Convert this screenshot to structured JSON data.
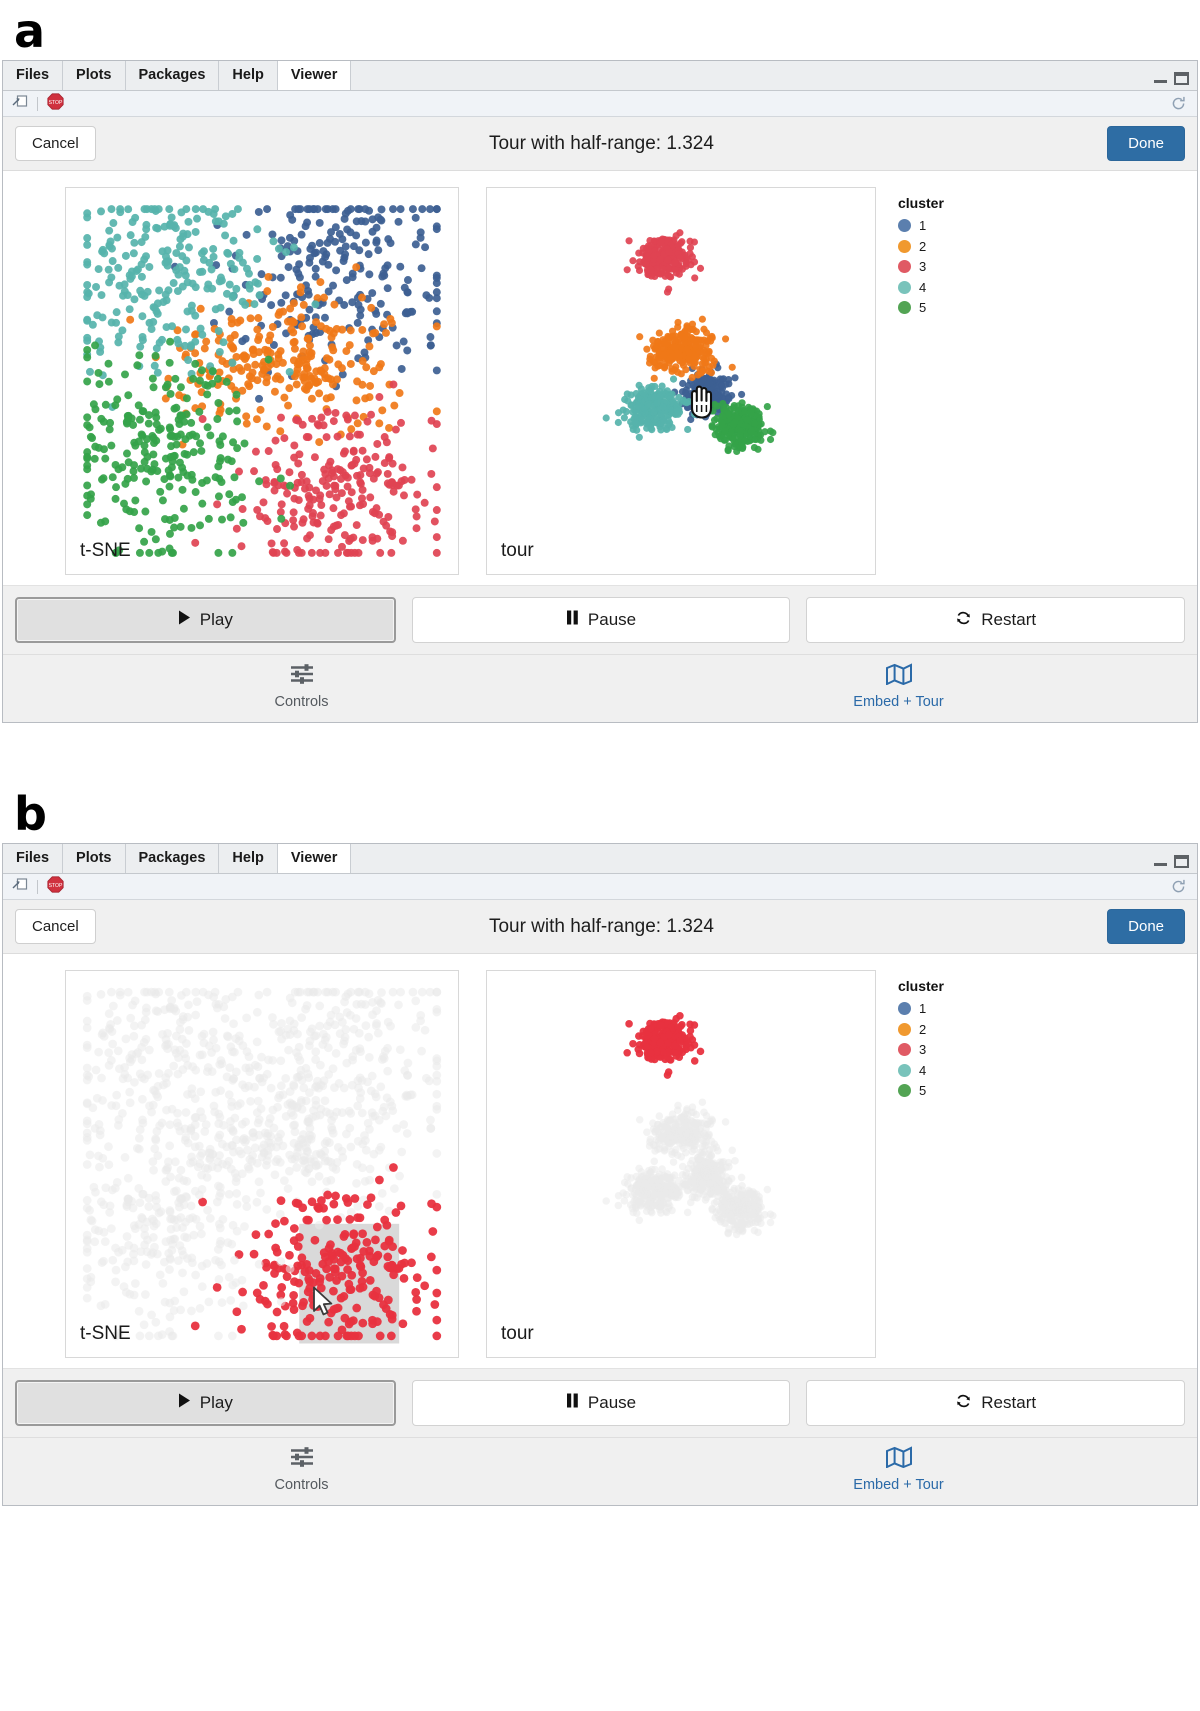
{
  "panels": [
    {
      "letter": "a",
      "tabs": [
        {
          "label": "Files",
          "active": false
        },
        {
          "label": "Plots",
          "active": false
        },
        {
          "label": "Packages",
          "active": false
        },
        {
          "label": "Help",
          "active": false
        },
        {
          "label": "Viewer",
          "active": true
        }
      ],
      "window_controls": {
        "minimize": "minimize-icon",
        "maximize": "maximize-icon"
      },
      "toolbar": {
        "popout": "popout-window-icon",
        "stop": "stop-icon",
        "refresh": "refresh-icon"
      },
      "header": {
        "cancel_label": "Cancel",
        "title": "Tour with half-range: 1.324",
        "done_label": "Done"
      },
      "plots": {
        "left_label": "t-SNE",
        "right_label": "tour",
        "faded": false,
        "selection_rect": false,
        "cursor": "hand-cursor-on-tour"
      },
      "legend": {
        "title": "cluster",
        "items": [
          {
            "label": "1",
            "color": "#5b7fae"
          },
          {
            "label": "2",
            "color": "#f0992f"
          },
          {
            "label": "3",
            "color": "#e05a64"
          },
          {
            "label": "4",
            "color": "#79c3bb"
          },
          {
            "label": "5",
            "color": "#53a454"
          }
        ]
      },
      "transport": [
        {
          "label": "Play",
          "icon": "play-icon",
          "pressed": true
        },
        {
          "label": "Pause",
          "icon": "pause-icon",
          "pressed": false
        },
        {
          "label": "Restart",
          "icon": "restart-icon",
          "pressed": false
        }
      ],
      "footer": [
        {
          "label": "Controls",
          "icon": "sliders-icon",
          "accent": false
        },
        {
          "label": "Embed + Tour",
          "icon": "map-icon",
          "accent": true
        }
      ]
    },
    {
      "letter": "b",
      "tabs": [
        {
          "label": "Files",
          "active": false
        },
        {
          "label": "Plots",
          "active": false
        },
        {
          "label": "Packages",
          "active": false
        },
        {
          "label": "Help",
          "active": false
        },
        {
          "label": "Viewer",
          "active": true
        }
      ],
      "window_controls": {
        "minimize": "minimize-icon",
        "maximize": "maximize-icon"
      },
      "toolbar": {
        "popout": "popout-window-icon",
        "stop": "stop-icon",
        "refresh": "refresh-icon"
      },
      "header": {
        "cancel_label": "Cancel",
        "title": "Tour with half-range: 1.324",
        "done_label": "Done"
      },
      "plots": {
        "left_label": "t-SNE",
        "right_label": "tour",
        "faded": true,
        "selection_rect": true,
        "cursor": "arrow-cursor-on-tsne"
      },
      "legend": {
        "title": "cluster",
        "items": [
          {
            "label": "1",
            "color": "#5b7fae"
          },
          {
            "label": "2",
            "color": "#f0992f"
          },
          {
            "label": "3",
            "color": "#e05a64"
          },
          {
            "label": "4",
            "color": "#79c3bb"
          },
          {
            "label": "5",
            "color": "#53a454"
          }
        ]
      },
      "transport": [
        {
          "label": "Play",
          "icon": "play-icon",
          "pressed": true
        },
        {
          "label": "Pause",
          "icon": "pause-icon",
          "pressed": false
        },
        {
          "label": "Restart",
          "icon": "restart-icon",
          "pressed": false
        }
      ],
      "footer": [
        {
          "label": "Controls",
          "icon": "sliders-icon",
          "accent": false
        },
        {
          "label": "Embed + Tour",
          "icon": "map-icon",
          "accent": true
        }
      ]
    }
  ],
  "chart_data": {
    "type": "scatter",
    "title": "t-SNE embedding and linked tour projection of 5 clusters",
    "xlabel": "",
    "ylabel": "",
    "grid": false,
    "legend_position": "right",
    "legend_title": "cluster",
    "series": [
      {
        "name": "1",
        "color": "#3d5f93",
        "n": 230,
        "tsne_center": [
          0.74,
          0.8
        ],
        "tsne_spread": [
          0.155,
          0.135
        ],
        "tour_center": [
          0.575,
          0.465
        ],
        "tour_spread": [
          0.03,
          0.028
        ]
      },
      {
        "name": "2",
        "color": "#f07818",
        "n": 250,
        "tsne_center": [
          0.565,
          0.555
        ],
        "tsne_spread": [
          0.15,
          0.09
        ],
        "tour_center": [
          0.505,
          0.585
        ],
        "tour_spread": [
          0.042,
          0.03
        ]
      },
      {
        "name": "3",
        "color": "#e04352",
        "n": 235,
        "tsne_center": [
          0.705,
          0.195
        ],
        "tsne_spread": [
          0.13,
          0.12
        ],
        "tour_center": [
          0.455,
          0.845
        ],
        "tour_spread": [
          0.035,
          0.028
        ]
      },
      {
        "name": "4",
        "color": "#56b3ab",
        "n": 240,
        "tsne_center": [
          0.255,
          0.795
        ],
        "tsne_spread": [
          0.145,
          0.125
        ],
        "tour_center": [
          0.43,
          0.425
        ],
        "tour_spread": [
          0.04,
          0.028
        ]
      },
      {
        "name": "5",
        "color": "#34a349",
        "n": 245,
        "tsne_center": [
          0.23,
          0.3
        ],
        "tsne_spread": [
          0.135,
          0.145
        ],
        "tour_center": [
          0.665,
          0.375
        ],
        "tour_spread": [
          0.035,
          0.03
        ]
      }
    ],
    "panel_a_state": "all clusters highlighted, no brush active",
    "panel_b_state": "cluster 3 brushed via rectangle on t-SNE, other clusters faded to near-white"
  }
}
